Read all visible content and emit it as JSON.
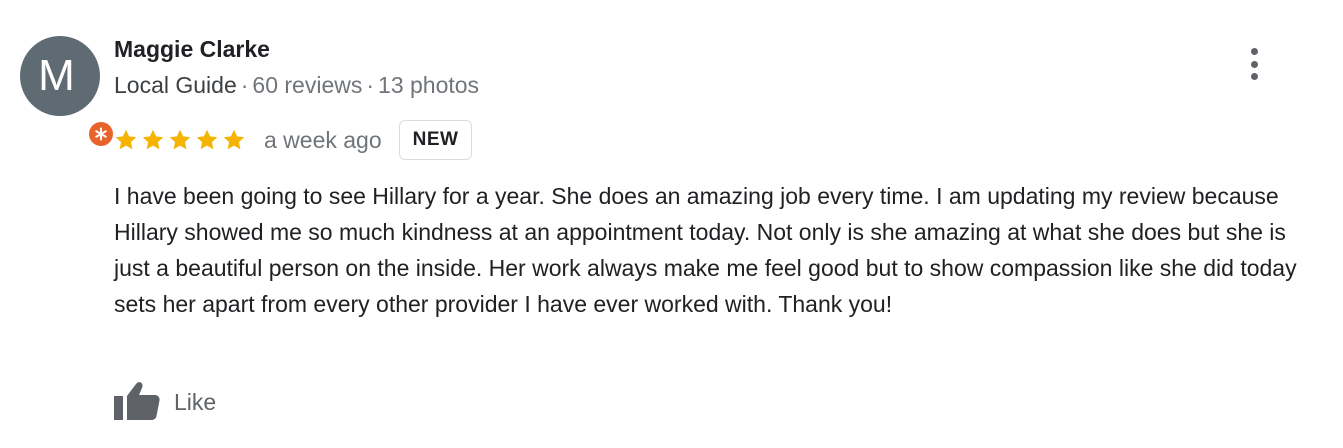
{
  "reviewer": {
    "initial": "M",
    "name": "Maggie Clarke",
    "guide_label": "Local Guide",
    "reviews": "60 reviews",
    "photos": "13 photos",
    "separator": "·"
  },
  "review": {
    "rating": 5,
    "max_rating": 5,
    "time": "a week ago",
    "badge": "NEW",
    "text": "I have been going to see Hillary for a year. She does an amazing job every time. I am updating my review because Hillary showed me so much kindness at an appointment today. Not only is she amazing at what she does but she is just a beautiful person on the inside. Her work always make me feel good but to show compassion like she did today sets her apart from every other provider I have ever worked with. Thank you!"
  },
  "actions": {
    "like_label": "Like"
  },
  "icons": {
    "more": "more-vert-icon",
    "star": "star-icon",
    "like": "thumbs-up-icon",
    "guide": "local-guide-badge-icon"
  },
  "colors": {
    "avatar_bg": "#5f6b73",
    "star": "#f4b400",
    "guide_badge": "#e8632b",
    "muted_text": "#70757a"
  }
}
